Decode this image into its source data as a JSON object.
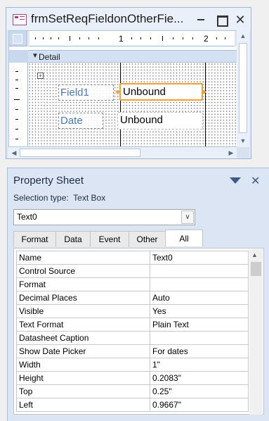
{
  "form_window": {
    "title": "frmSetReqFieldonOtherFie...",
    "ruler_labels": [
      "1",
      "2"
    ],
    "section_label": "Detail",
    "controls": [
      {
        "label": "Field1",
        "textbox": "Unbound",
        "selected": true
      },
      {
        "label": "Date",
        "textbox": "Unbound",
        "selected": false
      }
    ],
    "icons": [
      "form-icon",
      "minimize-icon",
      "maximize-icon",
      "close-icon",
      "section-arrow-icon",
      "move-handle-icon"
    ]
  },
  "property_sheet": {
    "title": "Property Sheet",
    "selection_type_label": "Selection type:",
    "selection_type_value": "Text Box",
    "selected_control": "Text0",
    "tabs": [
      {
        "label": "Format",
        "active": false
      },
      {
        "label": "Data",
        "active": false
      },
      {
        "label": "Event",
        "active": false
      },
      {
        "label": "Other",
        "active": false
      },
      {
        "label": "All",
        "active": true
      }
    ],
    "properties": [
      {
        "name": "Name",
        "value": "Text0"
      },
      {
        "name": "Control Source",
        "value": ""
      },
      {
        "name": "Format",
        "value": ""
      },
      {
        "name": "Decimal Places",
        "value": "Auto"
      },
      {
        "name": "Visible",
        "value": "Yes"
      },
      {
        "name": "Text Format",
        "value": "Plain Text"
      },
      {
        "name": "Datasheet Caption",
        "value": ""
      },
      {
        "name": "Show Date Picker",
        "value": "For dates"
      },
      {
        "name": "Width",
        "value": "1\""
      },
      {
        "name": "Height",
        "value": "0.2083\""
      },
      {
        "name": "Top",
        "value": "0.25\""
      },
      {
        "name": "Left",
        "value": "0.9667\""
      }
    ]
  },
  "colors": {
    "accent_selected": "#f0a030",
    "label_text": "#4a7ab0",
    "panel_blue": "#dbe5f3"
  }
}
